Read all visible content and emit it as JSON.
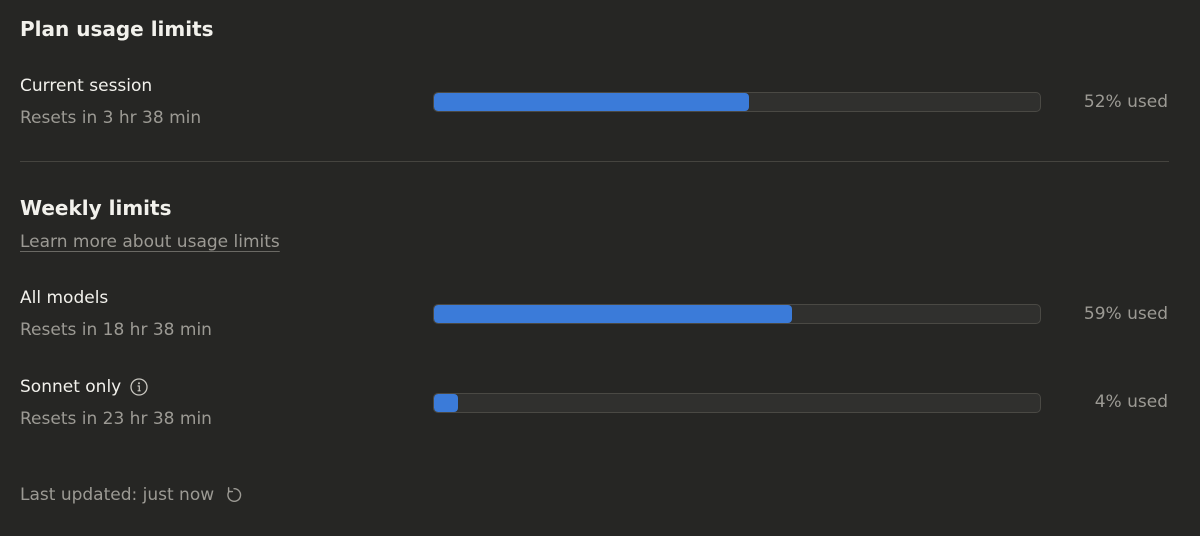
{
  "plan": {
    "heading": "Plan usage limits",
    "session": {
      "title": "Current session",
      "reset": "Resets in 3 hr 38 min",
      "used_label": "52% used",
      "used_percent": 52
    }
  },
  "weekly": {
    "heading": "Weekly limits",
    "learn_more": "Learn more about usage limits",
    "all_models": {
      "title": "All models",
      "reset": "Resets in 18 hr 38 min",
      "used_label": "59% used",
      "used_percent": 59
    },
    "sonnet": {
      "title": "Sonnet only",
      "reset": "Resets in 23 hr 38 min",
      "used_label": "4% used",
      "used_percent": 4
    }
  },
  "footer": {
    "last_updated": "Last updated: just now"
  },
  "icons": {
    "info": "info-icon",
    "refresh": "refresh-icon"
  },
  "colors": {
    "background": "#262624",
    "bar_fill": "#3b7bd9",
    "bar_track": "#30302e",
    "text_primary": "#f2f1ec",
    "text_secondary": "#9c9a94"
  }
}
